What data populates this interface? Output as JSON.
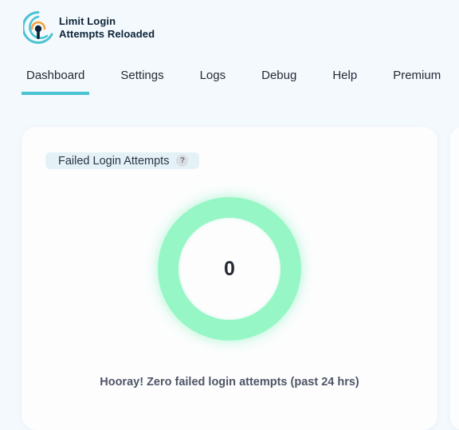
{
  "brand": {
    "line1": "Limit Login",
    "line2": "Attempts Reloaded",
    "accent_colors": [
      "#4ac3d2",
      "#f5a23a"
    ]
  },
  "tabs": [
    {
      "label": "Dashboard",
      "active": true
    },
    {
      "label": "Settings",
      "active": false
    },
    {
      "label": "Logs",
      "active": false
    },
    {
      "label": "Debug",
      "active": false
    },
    {
      "label": "Help",
      "active": false
    },
    {
      "label": "Premium",
      "active": false
    }
  ],
  "failed_attempts_card": {
    "label": "Failed Login Attempts",
    "help": "?",
    "count": "0",
    "ring_color": "#97f6c6",
    "message": "Hooray! Zero failed login attempts (past 24 hrs)"
  }
}
